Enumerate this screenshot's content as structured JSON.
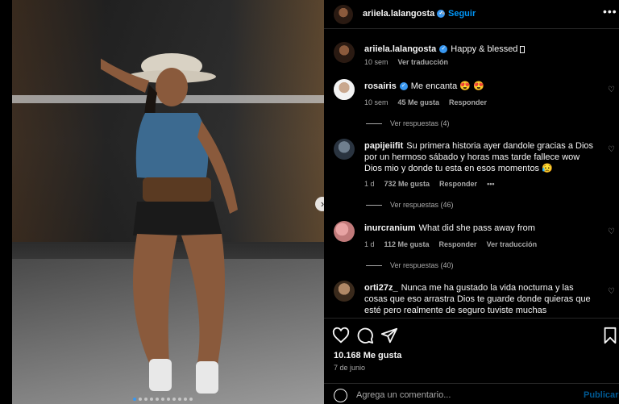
{
  "post": {
    "username": "ariiela.lalangosta",
    "follow_label": "Seguir",
    "separator": "•",
    "caption": "Happy & blessed ",
    "caption_time": "10 sem",
    "caption_translate": "Ver traducción",
    "likes": "10.168 Me gusta",
    "date": "7 de junio",
    "photo_count": 11,
    "active_photo": 1
  },
  "comments": [
    {
      "username": "rosairis",
      "verified": true,
      "text": "Me encanta 😍 😍",
      "time": "10 sem",
      "likes": "45 Me gusta",
      "reply": "Responder",
      "replies": "Ver respuestas (4)"
    },
    {
      "username": "papijeiifit",
      "verified": false,
      "text": "Su primera historia ayer dandole gracias a Dios por un hermoso sábado y horas mas tarde fallece wow Dios mio y donde tu esta en esos momentos 😥",
      "time": "1 d",
      "likes": "732 Me gusta",
      "reply": "Responder",
      "options": "•••",
      "replies": "Ver respuestas (46)"
    },
    {
      "username": "inurcranium",
      "verified": false,
      "text": "What did she pass away from",
      "time": "1 d",
      "likes": "112 Me gusta",
      "reply": "Responder",
      "translate": "Ver traducción",
      "replies": "Ver respuestas (40)"
    },
    {
      "username": "orti27z_",
      "verified": false,
      "text": "Nunca me ha gustado la vida nocturna y las cosas que eso arrastra Dios te guarde donde quieras que esté pero realmente de seguro tuviste muchas oportunidades donde"
    }
  ],
  "compose": {
    "placeholder": "Agrega un comentario...",
    "publish": "Publicar"
  },
  "icons": {
    "heart": "heart-icon",
    "comment": "comment-icon",
    "share": "share-icon",
    "save": "bookmark-icon",
    "emoji": "emoji-icon",
    "more": "more-icon"
  },
  "colors": {
    "accent": "#0095f6",
    "verified": "#3897f0",
    "muted": "#a8a8a8"
  }
}
